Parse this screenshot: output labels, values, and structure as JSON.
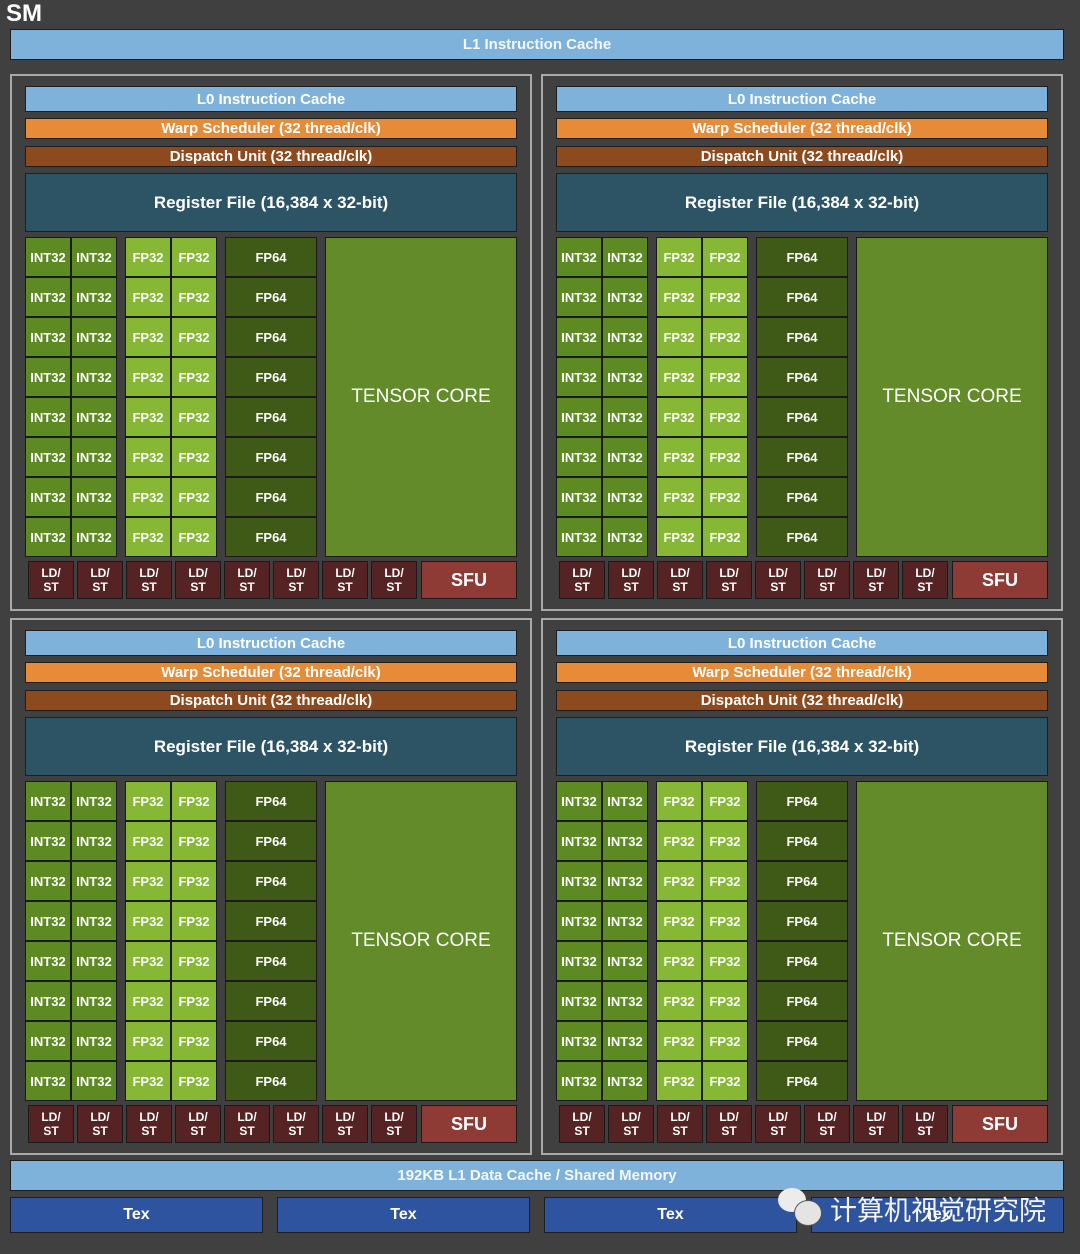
{
  "title": "SM",
  "l1_instruction_cache": "L1 Instruction Cache",
  "quadrants": [
    {
      "l0_cache": "L0 Instruction Cache",
      "warp_scheduler": "Warp Scheduler (32 thread/clk)",
      "dispatch_unit": "Dispatch Unit (32 thread/clk)",
      "register_file": "Register File (16,384 x 32-bit)",
      "int32_label": "INT32",
      "fp32_label": "FP32",
      "fp64_label": "FP64",
      "unit_rows": 8,
      "tensor_core": "TENSOR CORE",
      "ldst_top": "LD/",
      "ldst_bottom": "ST",
      "ldst_count": 8,
      "sfu": "SFU"
    },
    {
      "l0_cache": "L0 Instruction Cache",
      "warp_scheduler": "Warp Scheduler (32 thread/clk)",
      "dispatch_unit": "Dispatch Unit (32 thread/clk)",
      "register_file": "Register File (16,384 x 32-bit)",
      "int32_label": "INT32",
      "fp32_label": "FP32",
      "fp64_label": "FP64",
      "unit_rows": 8,
      "tensor_core": "TENSOR CORE",
      "ldst_top": "LD/",
      "ldst_bottom": "ST",
      "ldst_count": 8,
      "sfu": "SFU"
    },
    {
      "l0_cache": "L0 Instruction Cache",
      "warp_scheduler": "Warp Scheduler (32 thread/clk)",
      "dispatch_unit": "Dispatch Unit (32 thread/clk)",
      "register_file": "Register File (16,384 x 32-bit)",
      "int32_label": "INT32",
      "fp32_label": "FP32",
      "fp64_label": "FP64",
      "unit_rows": 8,
      "tensor_core": "TENSOR CORE",
      "ldst_top": "LD/",
      "ldst_bottom": "ST",
      "ldst_count": 8,
      "sfu": "SFU"
    },
    {
      "l0_cache": "L0 Instruction Cache",
      "warp_scheduler": "Warp Scheduler (32 thread/clk)",
      "dispatch_unit": "Dispatch Unit (32 thread/clk)",
      "register_file": "Register File (16,384 x 32-bit)",
      "int32_label": "INT32",
      "fp32_label": "FP32",
      "fp64_label": "FP64",
      "unit_rows": 8,
      "tensor_core": "TENSOR CORE",
      "ldst_top": "LD/",
      "ldst_bottom": "ST",
      "ldst_count": 8,
      "sfu": "SFU"
    }
  ],
  "l1_data_cache": "192KB L1 Data Cache / Shared Memory",
  "tex_units": [
    "Tex",
    "Tex",
    "Tex",
    "Tex"
  ],
  "watermark": {
    "icon": "wechat-icon",
    "text": "计算机视觉研究院"
  },
  "colors": {
    "background": "#404040",
    "cache": "#7fb2da",
    "warp_scheduler": "#e68c37",
    "dispatch_unit": "#8c4a1e",
    "register_file": "#2d5465",
    "int32": "#5d8a22",
    "fp32": "#86b735",
    "fp64": "#3f5a16",
    "tensor_core": "#638b29",
    "ldst": "#552323",
    "sfu": "#8f3b35",
    "tex": "#2e539f"
  }
}
